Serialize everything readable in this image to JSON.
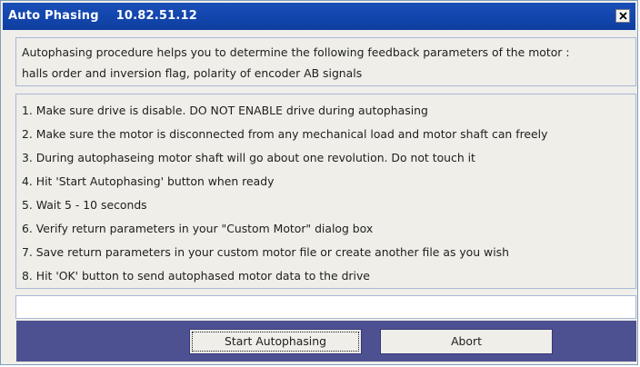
{
  "window": {
    "title": "Auto Phasing    10.82.51.12",
    "close_label": "close"
  },
  "intro": {
    "lines": [
      "Autophasing procedure helps you to determine the following feedback parameters of the motor :",
      "halls order and inversion flag, polarity of encoder AB signals"
    ]
  },
  "steps": [
    "1. Make sure drive is disable. DO NOT ENABLE drive during autophasing",
    "2. Make sure the motor is disconnected from any mechanical load and motor shaft can freely",
    "3. During autophaseing motor shaft will go about one revolution. Do not touch it",
    "4. Hit 'Start Autophasing' button when ready",
    "5. Wait 5 - 10 seconds",
    "6. Verify return parameters in your \"Custom Motor\" dialog box",
    "7. Save return parameters in your custom motor file or create another file as you wish",
    "8. Hit 'OK' button to send autophased motor data to the drive"
  ],
  "status": {
    "value": ""
  },
  "buttons": {
    "start": "Start Autophasing",
    "abort": "Abort"
  }
}
